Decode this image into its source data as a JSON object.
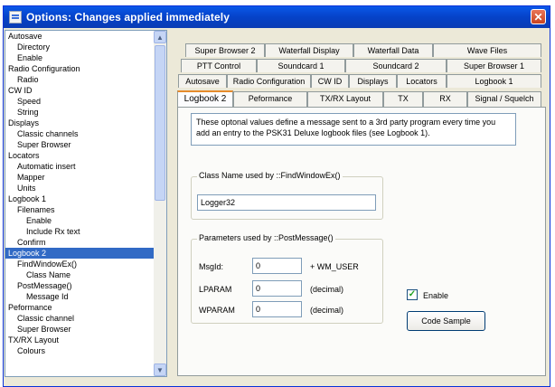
{
  "window": {
    "title": "Options: Changes applied immediately",
    "close_glyph": "✕"
  },
  "tree": {
    "items": [
      {
        "label": "Autosave",
        "indent": 0
      },
      {
        "label": "Directory",
        "indent": 1
      },
      {
        "label": "Enable",
        "indent": 1
      },
      {
        "label": "Radio Configuration",
        "indent": 0
      },
      {
        "label": "Radio",
        "indent": 1
      },
      {
        "label": "CW ID",
        "indent": 0
      },
      {
        "label": "Speed",
        "indent": 1
      },
      {
        "label": "String",
        "indent": 1
      },
      {
        "label": "Displays",
        "indent": 0
      },
      {
        "label": "Classic channels",
        "indent": 1
      },
      {
        "label": "Super Browser",
        "indent": 1
      },
      {
        "label": "Locators",
        "indent": 0
      },
      {
        "label": "Automatic insert",
        "indent": 1
      },
      {
        "label": "Mapper",
        "indent": 1
      },
      {
        "label": "Units",
        "indent": 1
      },
      {
        "label": "Logbook 1",
        "indent": 0
      },
      {
        "label": "Filenames",
        "indent": 1
      },
      {
        "label": "Enable",
        "indent": 2
      },
      {
        "label": "Include Rx text",
        "indent": 2
      },
      {
        "label": "Confirm",
        "indent": 1
      },
      {
        "label": "Logbook 2",
        "indent": 0,
        "selected": true
      },
      {
        "label": "FindWindowEx()",
        "indent": 1
      },
      {
        "label": "Class Name",
        "indent": 2
      },
      {
        "label": "PostMessage()",
        "indent": 1
      },
      {
        "label": "Message Id",
        "indent": 2
      },
      {
        "label": "Peformance",
        "indent": 0
      },
      {
        "label": "Classic channel",
        "indent": 1
      },
      {
        "label": "Super Browser",
        "indent": 1
      },
      {
        "label": "TX/RX Layout",
        "indent": 0
      },
      {
        "label": "Colours",
        "indent": 1
      }
    ]
  },
  "tabs": {
    "row1": [
      "Super Browser 2",
      "Waterfall Display",
      "Waterfall Data",
      "Wave Files"
    ],
    "row2": [
      "PTT Control",
      "Soundcard 1",
      "Soundcard 2",
      "Super Browser 1"
    ],
    "row3": [
      "Autosave",
      "Radio Configuration",
      "CW ID",
      "Displays",
      "Locators",
      "Logbook 1"
    ],
    "row4": [
      "Logbook 2",
      "Peformance",
      "TX/RX Layout",
      "TX",
      "RX",
      "Signal / Squelch"
    ],
    "active": "Logbook 2"
  },
  "panel": {
    "info_text": "These optonal values define a message sent to a 3rd party program every time you add an entry to the PSK31 Deluxe logbook files (see Logbook 1).",
    "class_group": {
      "title": "Class Name used by ::FindWindowEx()",
      "value": "Logger32"
    },
    "params_group": {
      "title": "Parameters used by ::PostMessage()",
      "rows": [
        {
          "label": "MsgId:",
          "value": "0",
          "suffix": "+ WM_USER"
        },
        {
          "label": "LPARAM",
          "value": "0",
          "suffix": "(decimal)"
        },
        {
          "label": "WPARAM",
          "value": "0",
          "suffix": "(decimal)"
        }
      ]
    },
    "enable": {
      "label": "Enable",
      "checked": true,
      "check_glyph": "✓"
    },
    "code_sample_button": "Code Sample"
  },
  "scrollbar": {
    "up_glyph": "▲",
    "down_glyph": "▼"
  }
}
